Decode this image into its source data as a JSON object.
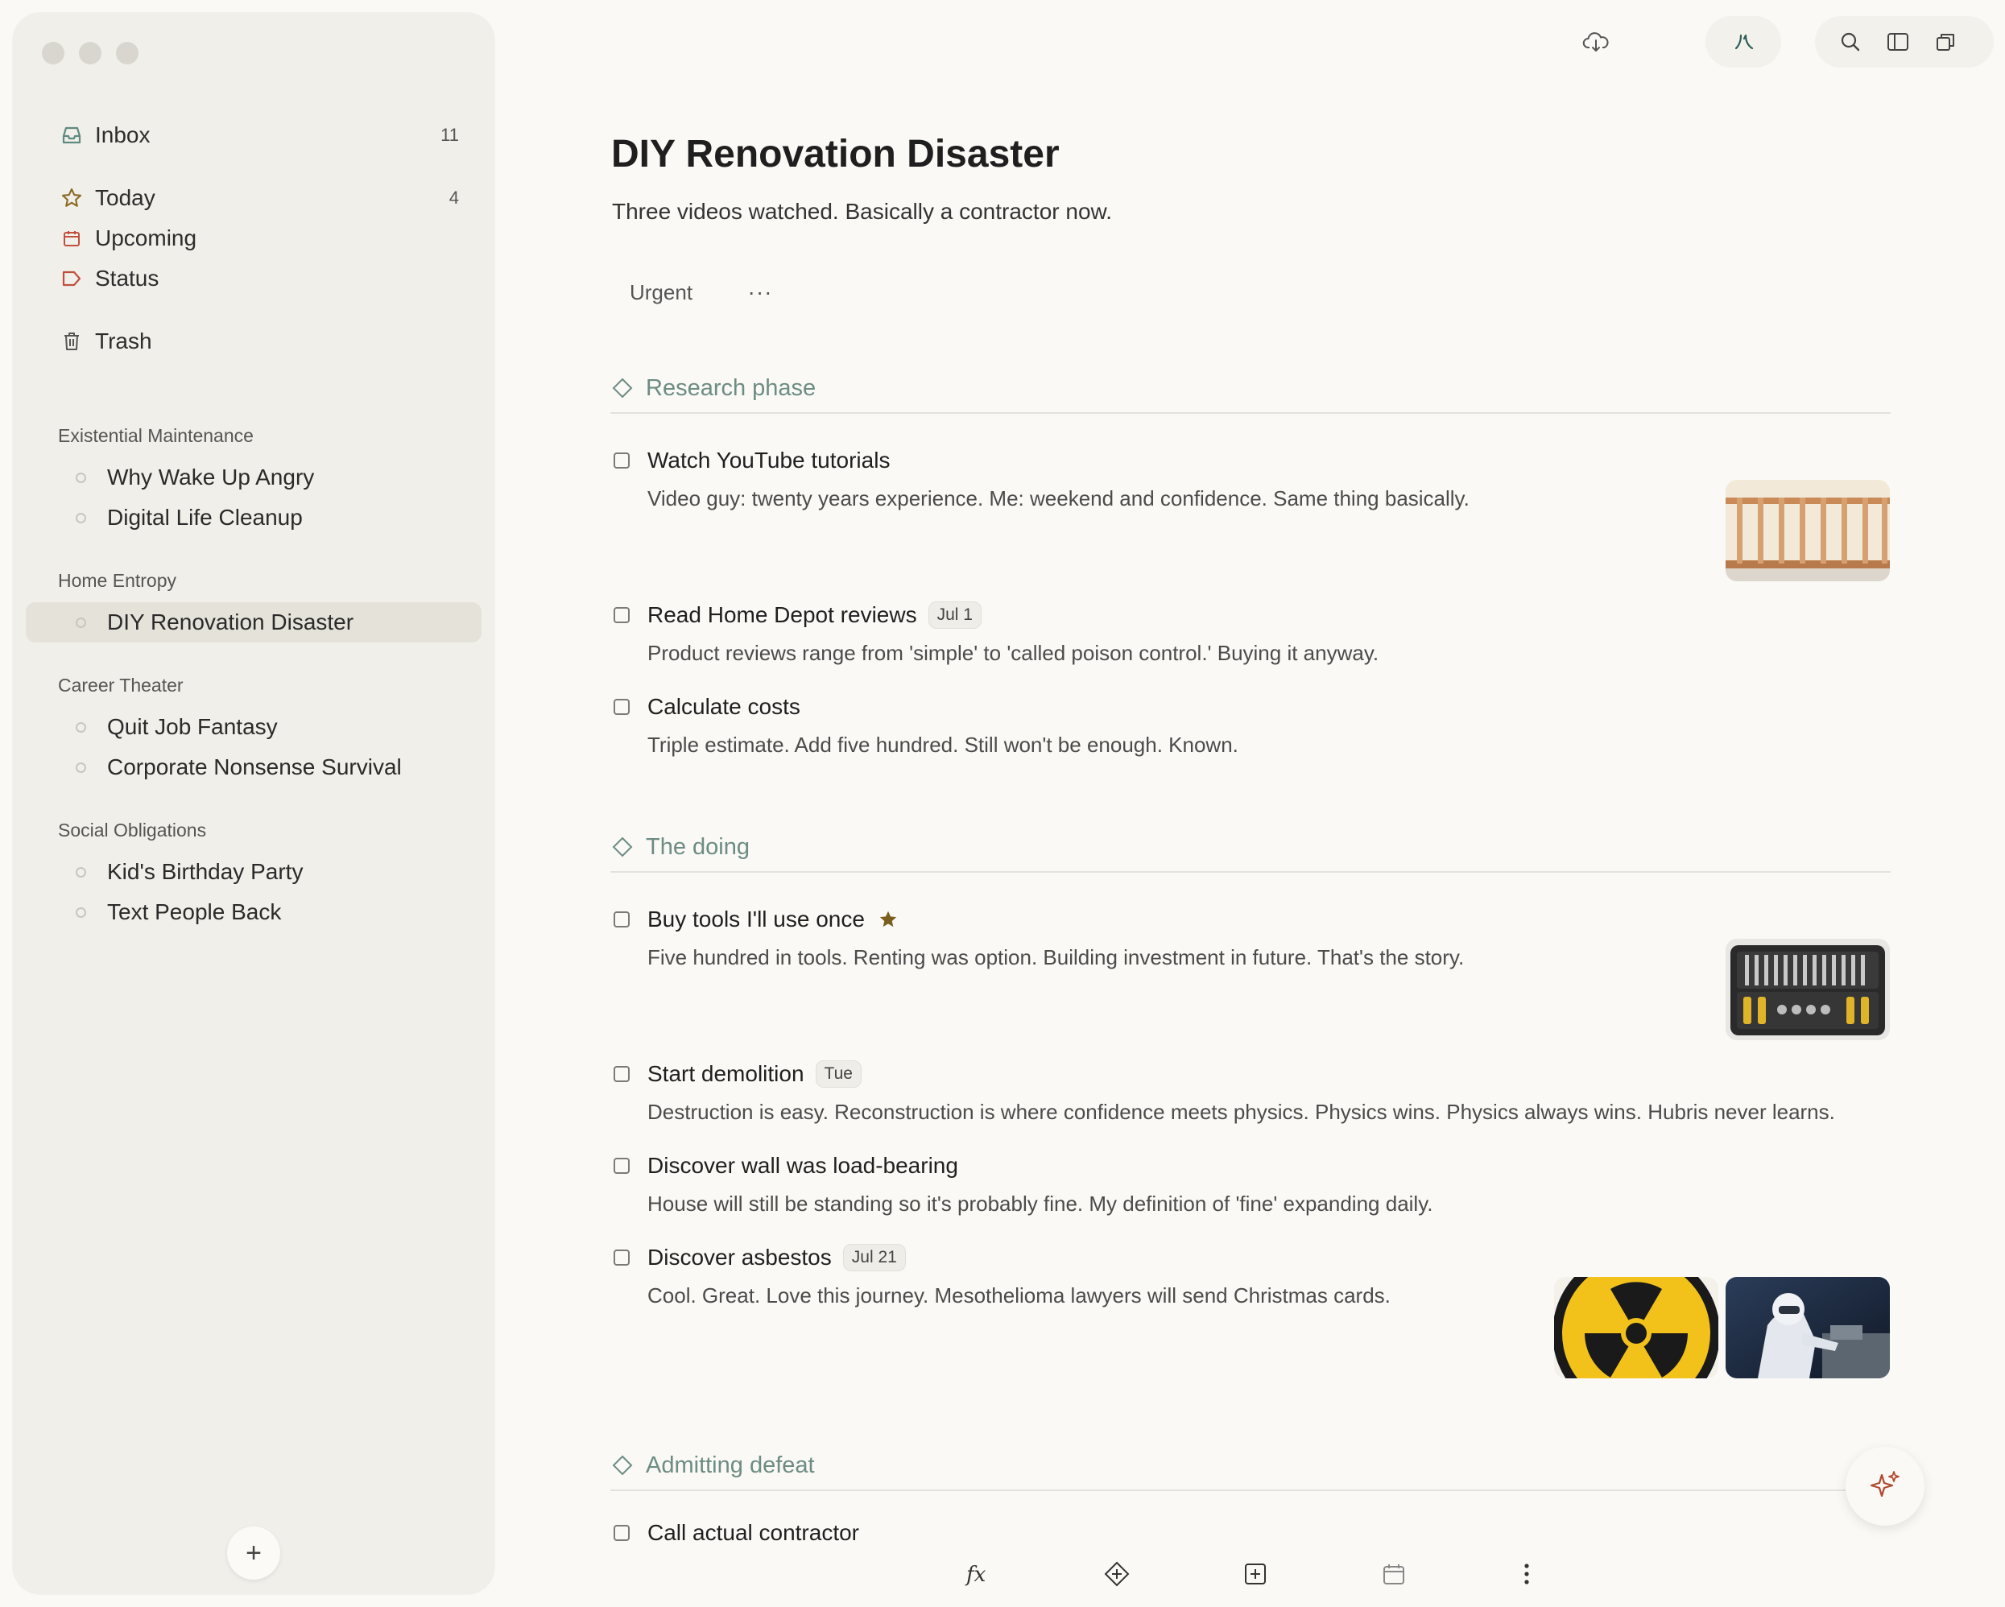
{
  "sidebar": {
    "nav": [
      {
        "label": "Inbox",
        "count": "11",
        "icon": "inbox-icon"
      },
      {
        "label": "Today",
        "count": "4",
        "icon": "star-icon"
      },
      {
        "label": "Upcoming",
        "count": "",
        "icon": "calendar-icon"
      },
      {
        "label": "Status",
        "count": "",
        "icon": "tag-icon"
      },
      {
        "label": "Trash",
        "count": "",
        "icon": "trash-icon"
      }
    ],
    "groups": [
      {
        "label": "Existential Maintenance",
        "projects": [
          "Why Wake Up Angry",
          "Digital Life Cleanup"
        ]
      },
      {
        "label": "Home Entropy",
        "projects": [
          "DIY Renovation Disaster"
        ]
      },
      {
        "label": "Career Theater",
        "projects": [
          "Quit Job Fantasy",
          "Corporate Nonsense Survival"
        ]
      },
      {
        "label": "Social Obligations",
        "projects": [
          "Kid's Birthday Party",
          "Text People Back"
        ]
      }
    ],
    "add_label": "+"
  },
  "toolbar": {
    "icons": [
      "cloud-sync-icon",
      "assistant-icon",
      "search-icon",
      "sidebar-toggle-icon",
      "window-icon"
    ]
  },
  "project": {
    "title": "DIY Renovation Disaster",
    "subtitle": "Three videos watched. Basically a contractor now.",
    "tag": "Urgent",
    "more": "···"
  },
  "sections": [
    {
      "title": "Research phase",
      "tasks": [
        {
          "name": "Watch YouTube tutorials",
          "date": "",
          "note": "Video guy: twenty years experience. Me: weekend and confidence. Same thing basically."
        },
        {
          "name": "Read Home Depot reviews",
          "date": "Jul 1",
          "note": "Product reviews range from 'simple' to 'called poison control.' Buying it anyway."
        },
        {
          "name": "Calculate costs",
          "date": "",
          "note": "Triple estimate. Add five hundred. Still won't be enough. Known."
        }
      ]
    },
    {
      "title": "The doing",
      "tasks": [
        {
          "name": "Buy tools I'll use once",
          "date": "",
          "starred": true,
          "note": "Five hundred in tools. Renting was option. Building investment in future. That's the story."
        },
        {
          "name": "Start demolition",
          "date": "Tue",
          "note": "Destruction is easy. Reconstruction is where confidence meets physics. Physics wins. Physics always wins. Hubris never learns."
        },
        {
          "name": "Discover wall was load-bearing",
          "date": "",
          "note": "House will still be standing so it's probably fine. My definition of 'fine' expanding daily."
        },
        {
          "name": "Discover asbestos",
          "date": "Jul 21",
          "note": "Cool. Great. Love this journey. Mesothelioma lawyers will send Christmas cards."
        }
      ]
    },
    {
      "title": "Admitting defeat",
      "tasks": [
        {
          "name": "Call actual contractor",
          "date": "",
          "note": ""
        }
      ]
    }
  ],
  "colors": {
    "accent_section": "#6c8c84",
    "star": "#7a5e1f",
    "calendar": "#c0503d"
  }
}
